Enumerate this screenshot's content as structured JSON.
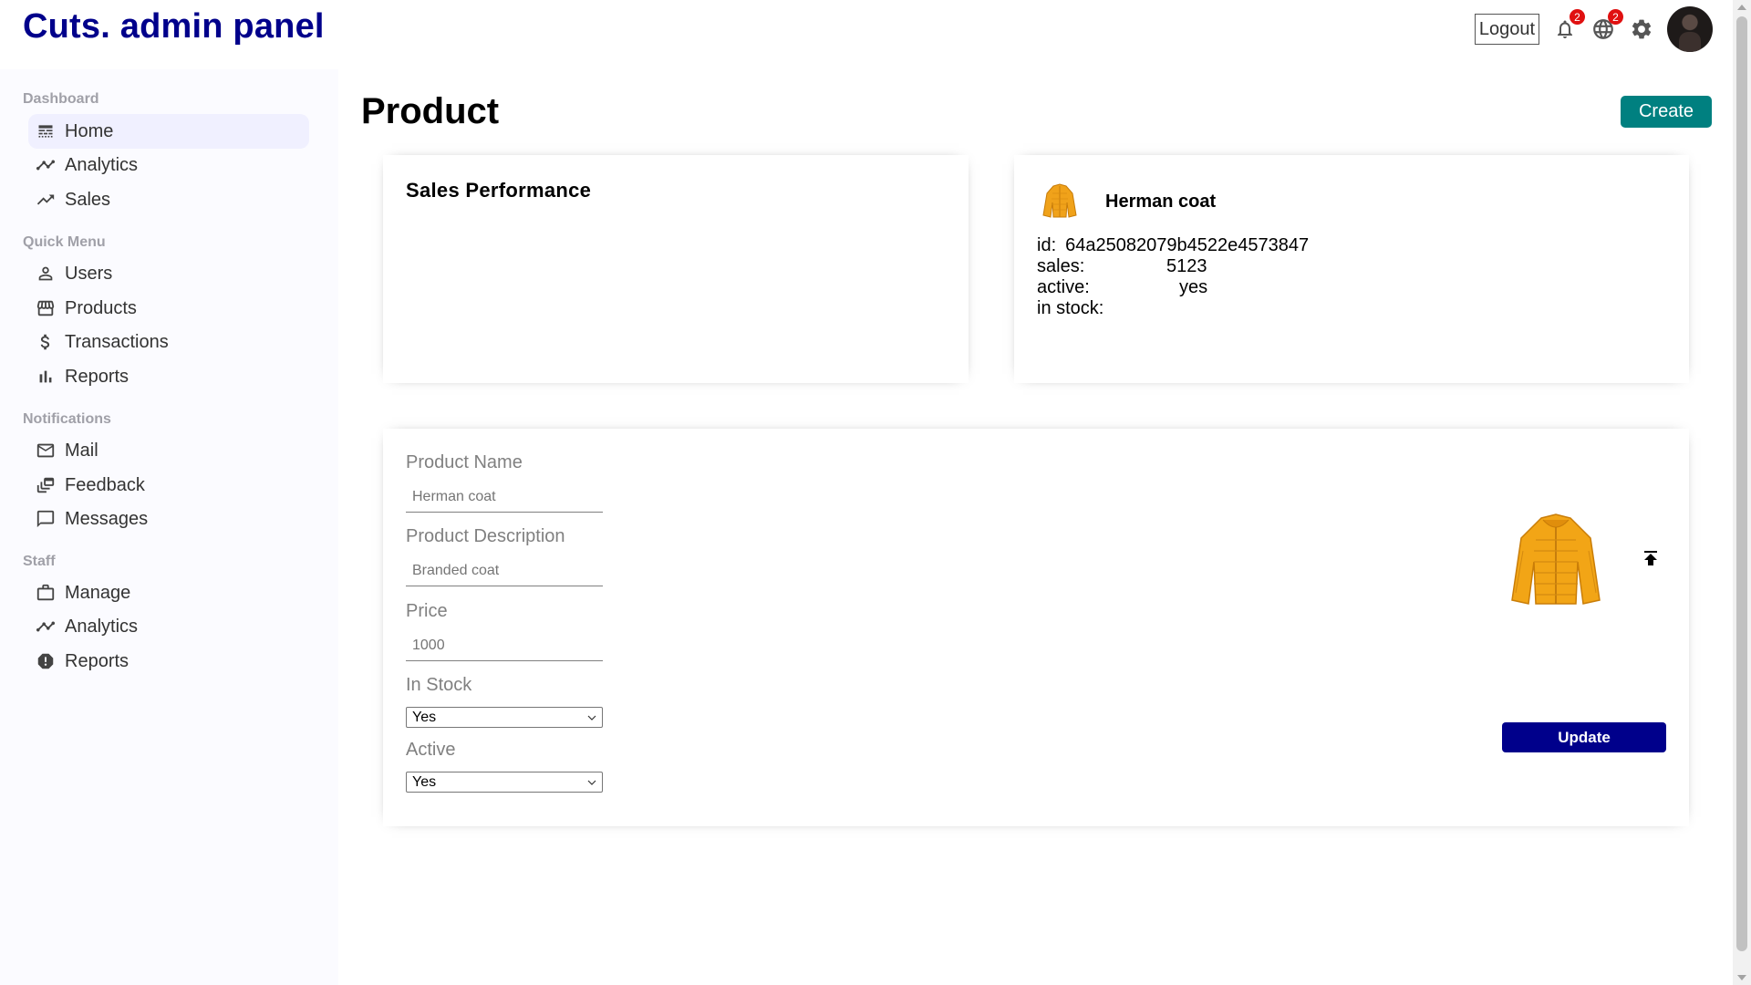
{
  "app": {
    "title": "Cuts. admin panel"
  },
  "topbar": {
    "logout_label": "Logout",
    "notifications_count": "2",
    "language_count": "2",
    "icons": [
      "bell-icon",
      "globe-icon",
      "gear-icon",
      "avatar"
    ]
  },
  "sidebar": {
    "sections": [
      {
        "title": "Dashboard",
        "items": [
          {
            "label": "Home",
            "icon": "line-style-icon",
            "active": true
          },
          {
            "label": "Analytics",
            "icon": "timeline-icon"
          },
          {
            "label": "Sales",
            "icon": "trending-up-icon"
          }
        ]
      },
      {
        "title": "Quick Menu",
        "items": [
          {
            "label": "Users",
            "icon": "person-outline-icon"
          },
          {
            "label": "Products",
            "icon": "storefront-icon"
          },
          {
            "label": "Transactions",
            "icon": "dollar-icon"
          },
          {
            "label": "Reports",
            "icon": "bar-chart-icon"
          }
        ]
      },
      {
        "title": "Notifications",
        "items": [
          {
            "label": "Mail",
            "icon": "mail-outline-icon"
          },
          {
            "label": "Feedback",
            "icon": "dynamic-feed-icon"
          },
          {
            "label": "Messages",
            "icon": "chat-bubble-outline-icon"
          }
        ]
      },
      {
        "title": "Staff",
        "items": [
          {
            "label": "Manage",
            "icon": "work-outline-icon"
          },
          {
            "label": "Analytics",
            "icon": "timeline-icon"
          },
          {
            "label": "Reports",
            "icon": "report-icon"
          }
        ]
      }
    ]
  },
  "main": {
    "title": "Product",
    "create_label": "Create",
    "performance": {
      "title": "Sales Performance"
    },
    "info": {
      "name": "Herman coat",
      "rows": [
        {
          "key": "id:",
          "value": "64a25082079b4522e4573847"
        },
        {
          "key": "sales:",
          "value": "5123"
        },
        {
          "key": "active:",
          "value": "yes"
        },
        {
          "key": "in stock:",
          "value": ""
        }
      ]
    },
    "form": {
      "name_label": "Product Name",
      "name_placeholder": "Herman coat",
      "desc_label": "Product Description",
      "desc_placeholder": "Branded coat",
      "price_label": "Price",
      "price_placeholder": "1000",
      "stock_label": "In Stock",
      "stock_value": "Yes",
      "active_label": "Active",
      "active_value": "Yes",
      "update_label": "Update"
    }
  },
  "colors": {
    "brand": "#00008b",
    "create_button": "#008080",
    "update_button": "#00008b",
    "badge": "#e01010",
    "sidebar_bg": "#fbfbff",
    "active_item_bg": "#f0f0ff"
  }
}
